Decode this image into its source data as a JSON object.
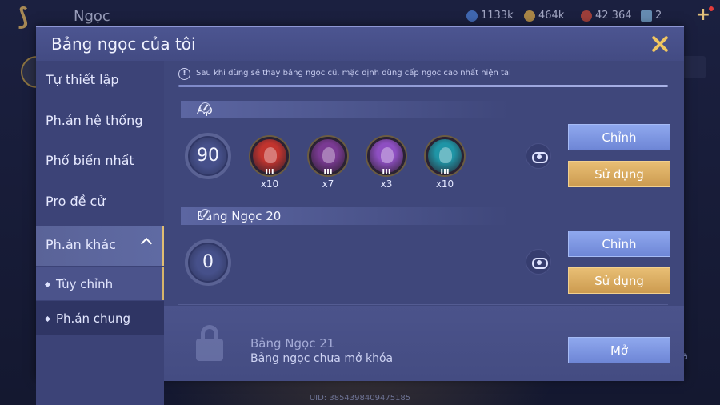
{
  "background": {
    "title": "Ngọc",
    "resources": [
      {
        "value": "1133k",
        "icon": "blue-crystal-icon",
        "color": "#4d7fd6"
      },
      {
        "value": "464k",
        "icon": "gold-coin-icon",
        "color": "#d9a84a"
      },
      {
        "value": "42 364",
        "icon": "red-gem-icon",
        "color": "#c94a3a"
      },
      {
        "value": "2",
        "icon": "card-icon",
        "color": "#7fb0d8"
      }
    ],
    "uid": "UID: 3854398409475185"
  },
  "modal": {
    "title": "Bảng ngọc của tôi"
  },
  "sidebar": {
    "items": [
      {
        "label": "Tự thiết lập"
      },
      {
        "label": "Ph.án hệ thống"
      },
      {
        "label": "Phổ biến nhất"
      },
      {
        "label": "Pro đề cử"
      },
      {
        "label": "Ph.án khác"
      }
    ],
    "subitems": [
      {
        "label": "Tùy chỉnh"
      },
      {
        "label": "Ph.án chung"
      }
    ]
  },
  "notice": "Sau khi dùng sẽ thay bảng ngọc cũ, mặc định dùng cấp ngọc cao nhất hiện tại",
  "pages": [
    {
      "name": "Ap",
      "level": "90",
      "gems": [
        {
          "color": "#c2342e",
          "count": "x10",
          "rank": "III"
        },
        {
          "color": "#7a3a93",
          "count": "x7",
          "rank": "III"
        },
        {
          "color": "#8e4fc2",
          "count": "x3",
          "rank": "III"
        },
        {
          "color": "#1f95a6",
          "count": "x10",
          "rank": "III"
        }
      ],
      "edit_label": "Chỉnh",
      "use_label": "Sử dụng"
    },
    {
      "name": "Bảng Ngọc 20",
      "level": "0",
      "gems": [],
      "edit_label": "Chỉnh",
      "use_label": "Sử dụng"
    }
  ],
  "locked": {
    "name": "Bảng Ngọc 21",
    "status": "Bảng ngọc chưa mở khóa",
    "unlock_label": "Mở"
  }
}
